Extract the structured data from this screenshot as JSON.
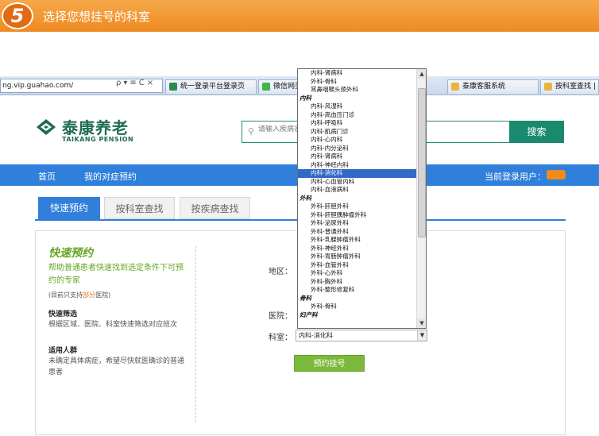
{
  "banner": {
    "step": "5",
    "title": "选择您想挂号的科室"
  },
  "browser": {
    "address": "ng.vip.guahao.com/",
    "address_icons": "ρ▾≡C×",
    "tabs": [
      {
        "label": "统一登录平台登录页",
        "icon_color": "#2c8a4a"
      },
      {
        "label": "微信网页",
        "icon_color": "#3fb54a"
      },
      {
        "label": "泰康客服系统",
        "icon_color": "#e9b53b"
      },
      {
        "label": "按科室查找 | 挂",
        "icon_color": "#e9b53b"
      }
    ]
  },
  "site": {
    "logo_cn": "泰康养老",
    "logo_en": "TAIKANG PENSION",
    "search_placeholder": "请输入疾病名",
    "search_button": "搜索"
  },
  "nav": {
    "home": "首页",
    "mine": "我的对症预约",
    "login_status": "当前登录用户："
  },
  "tabs": {
    "quick": "快速预约",
    "by_dept": "按科室查找",
    "by_disease": "按疾病查找"
  },
  "panel": {
    "title": "快速预约",
    "desc": "帮助普通患者快速找到选定条件下可预约的专家",
    "note_pre": "(目前只支持",
    "note_hl": "部分",
    "note_post": "医院)",
    "filter_head": "快速筛选",
    "filter_text": "根据区域、医院、科室快速筛选对应班次",
    "crowd_head": "适用人群",
    "crowd_text": "未确定具体病症，希望尽快就医确诊的普通患者"
  },
  "form": {
    "region_label": "地区：",
    "hospital_label": "医院：",
    "dept_label": "科室：",
    "dept_value": "内科-消化科",
    "submit": "预约挂号"
  },
  "dropdown": {
    "options": [
      {
        "label": "内科-肾病科",
        "group": false
      },
      {
        "label": "外科-骨科",
        "group": false
      },
      {
        "label": "耳鼻咽喉头颈外科",
        "group": false
      },
      {
        "label": "内科",
        "group": true
      },
      {
        "label": "内科-风湿科",
        "group": false
      },
      {
        "label": "内科-高血压门诊",
        "group": false
      },
      {
        "label": "内科-呼吸科",
        "group": false
      },
      {
        "label": "内科-肌病门诊",
        "group": false
      },
      {
        "label": "内科-心内科",
        "group": false
      },
      {
        "label": "内科-内分泌科",
        "group": false
      },
      {
        "label": "内科-肾病科",
        "group": false
      },
      {
        "label": "内科-神经内科",
        "group": false
      },
      {
        "label": "内科-消化科",
        "group": false,
        "selected": true
      },
      {
        "label": "内科-心血管内科",
        "group": false
      },
      {
        "label": "内科-血液病科",
        "group": false
      },
      {
        "label": "外科",
        "group": true
      },
      {
        "label": "外科-肝胆外科",
        "group": false
      },
      {
        "label": "外科-肝胆胰肿瘤外科",
        "group": false
      },
      {
        "label": "外科-泌尿外科",
        "group": false
      },
      {
        "label": "外科-普通外科",
        "group": false
      },
      {
        "label": "外科-乳腺肿瘤外科",
        "group": false
      },
      {
        "label": "外科-神经外科",
        "group": false
      },
      {
        "label": "外科-胃肠肿瘤外科",
        "group": false
      },
      {
        "label": "外科-血管外科",
        "group": false
      },
      {
        "label": "外科-心外科",
        "group": false
      },
      {
        "label": "外科-胸外科",
        "group": false
      },
      {
        "label": "外科-整形修复科",
        "group": false
      },
      {
        "label": "骨科",
        "group": true
      },
      {
        "label": "外科-骨科",
        "group": false
      },
      {
        "label": "妇产科",
        "group": true
      }
    ]
  }
}
